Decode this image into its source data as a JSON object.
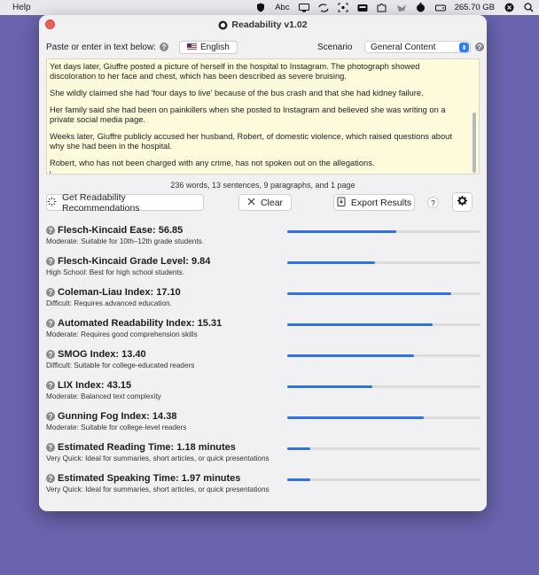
{
  "menubar": {
    "help": "Help",
    "abc": "Abc",
    "storage": "265.70 GB"
  },
  "window": {
    "title": "Readability v1.02"
  },
  "input": {
    "label": "Paste or enter in text below:",
    "language": "English",
    "scenario_label": "Scenario",
    "scenario_value": "General Content",
    "paragraphs": [
      "Yet days later, Giuffre posted a picture of herself in the hospital to Instagram. The photograph showed discoloration to her face and chest, which has been described as severe bruising.",
      "She wildly claimed she had 'four days to live' because of the bus crash and that she had kidney failure.",
      "Her family said she had been on painkillers when she posted to Instagram and believed she was writing on a private social media page.",
      "Weeks later, Giuffre publicly accused her husband, Robert, of domestic violence, which raised questions about why she had been in the hospital.",
      "Robert, who has not been charged with any crime, has not spoken out on the allegations."
    ],
    "stats": "236 words, 13 sentences, 9 paragraphs, and 1 page"
  },
  "toolbar": {
    "recommend_label": "Get Readability Recommendations",
    "clear_label": "Clear",
    "export_label": "Export Results",
    "help_label": "?"
  },
  "metrics": [
    {
      "title": "Flesch-Kincaid Ease: 56.85",
      "desc": "Moderate: Suitable for 10th–12th grade students.",
      "level": 0.565
    },
    {
      "title": "Flesch-Kincaid Grade Level: 9.84",
      "desc": "High School: Best for high school students.",
      "level": 0.455
    },
    {
      "title": "Coleman-Liau Index: 17.10",
      "desc": "Difficult: Requires advanced education.",
      "level": 0.85
    },
    {
      "title": "Automated Readability Index: 15.31",
      "desc": "Moderate: Requires good comprehension skills",
      "level": 0.75
    },
    {
      "title": "SMOG Index: 13.40",
      "desc": "Difficult: Suitable for college-educated readers",
      "level": 0.655
    },
    {
      "title": "LIX Index: 43.15",
      "desc": "Moderate: Balanced text complexity",
      "level": 0.44
    },
    {
      "title": "Gunning Fog Index: 14.38",
      "desc": "Moderate: Suitable for college-level readers",
      "level": 0.705
    },
    {
      "title": "Estimated Reading Time: 1.18 minutes",
      "desc": "Very Quick: Ideal for summaries, short articles, or quick presentations",
      "level": 0.12
    },
    {
      "title": "Estimated Speaking Time: 1.97 minutes",
      "desc": "Very Quick: Ideal for summaries, short articles, or quick presentations",
      "level": 0.12
    }
  ],
  "colors": {
    "accent": "#2f73e0",
    "textarea_bg": "#fdfbdc",
    "desktop": "#6a63ae",
    "close": "#ec5f5a"
  }
}
